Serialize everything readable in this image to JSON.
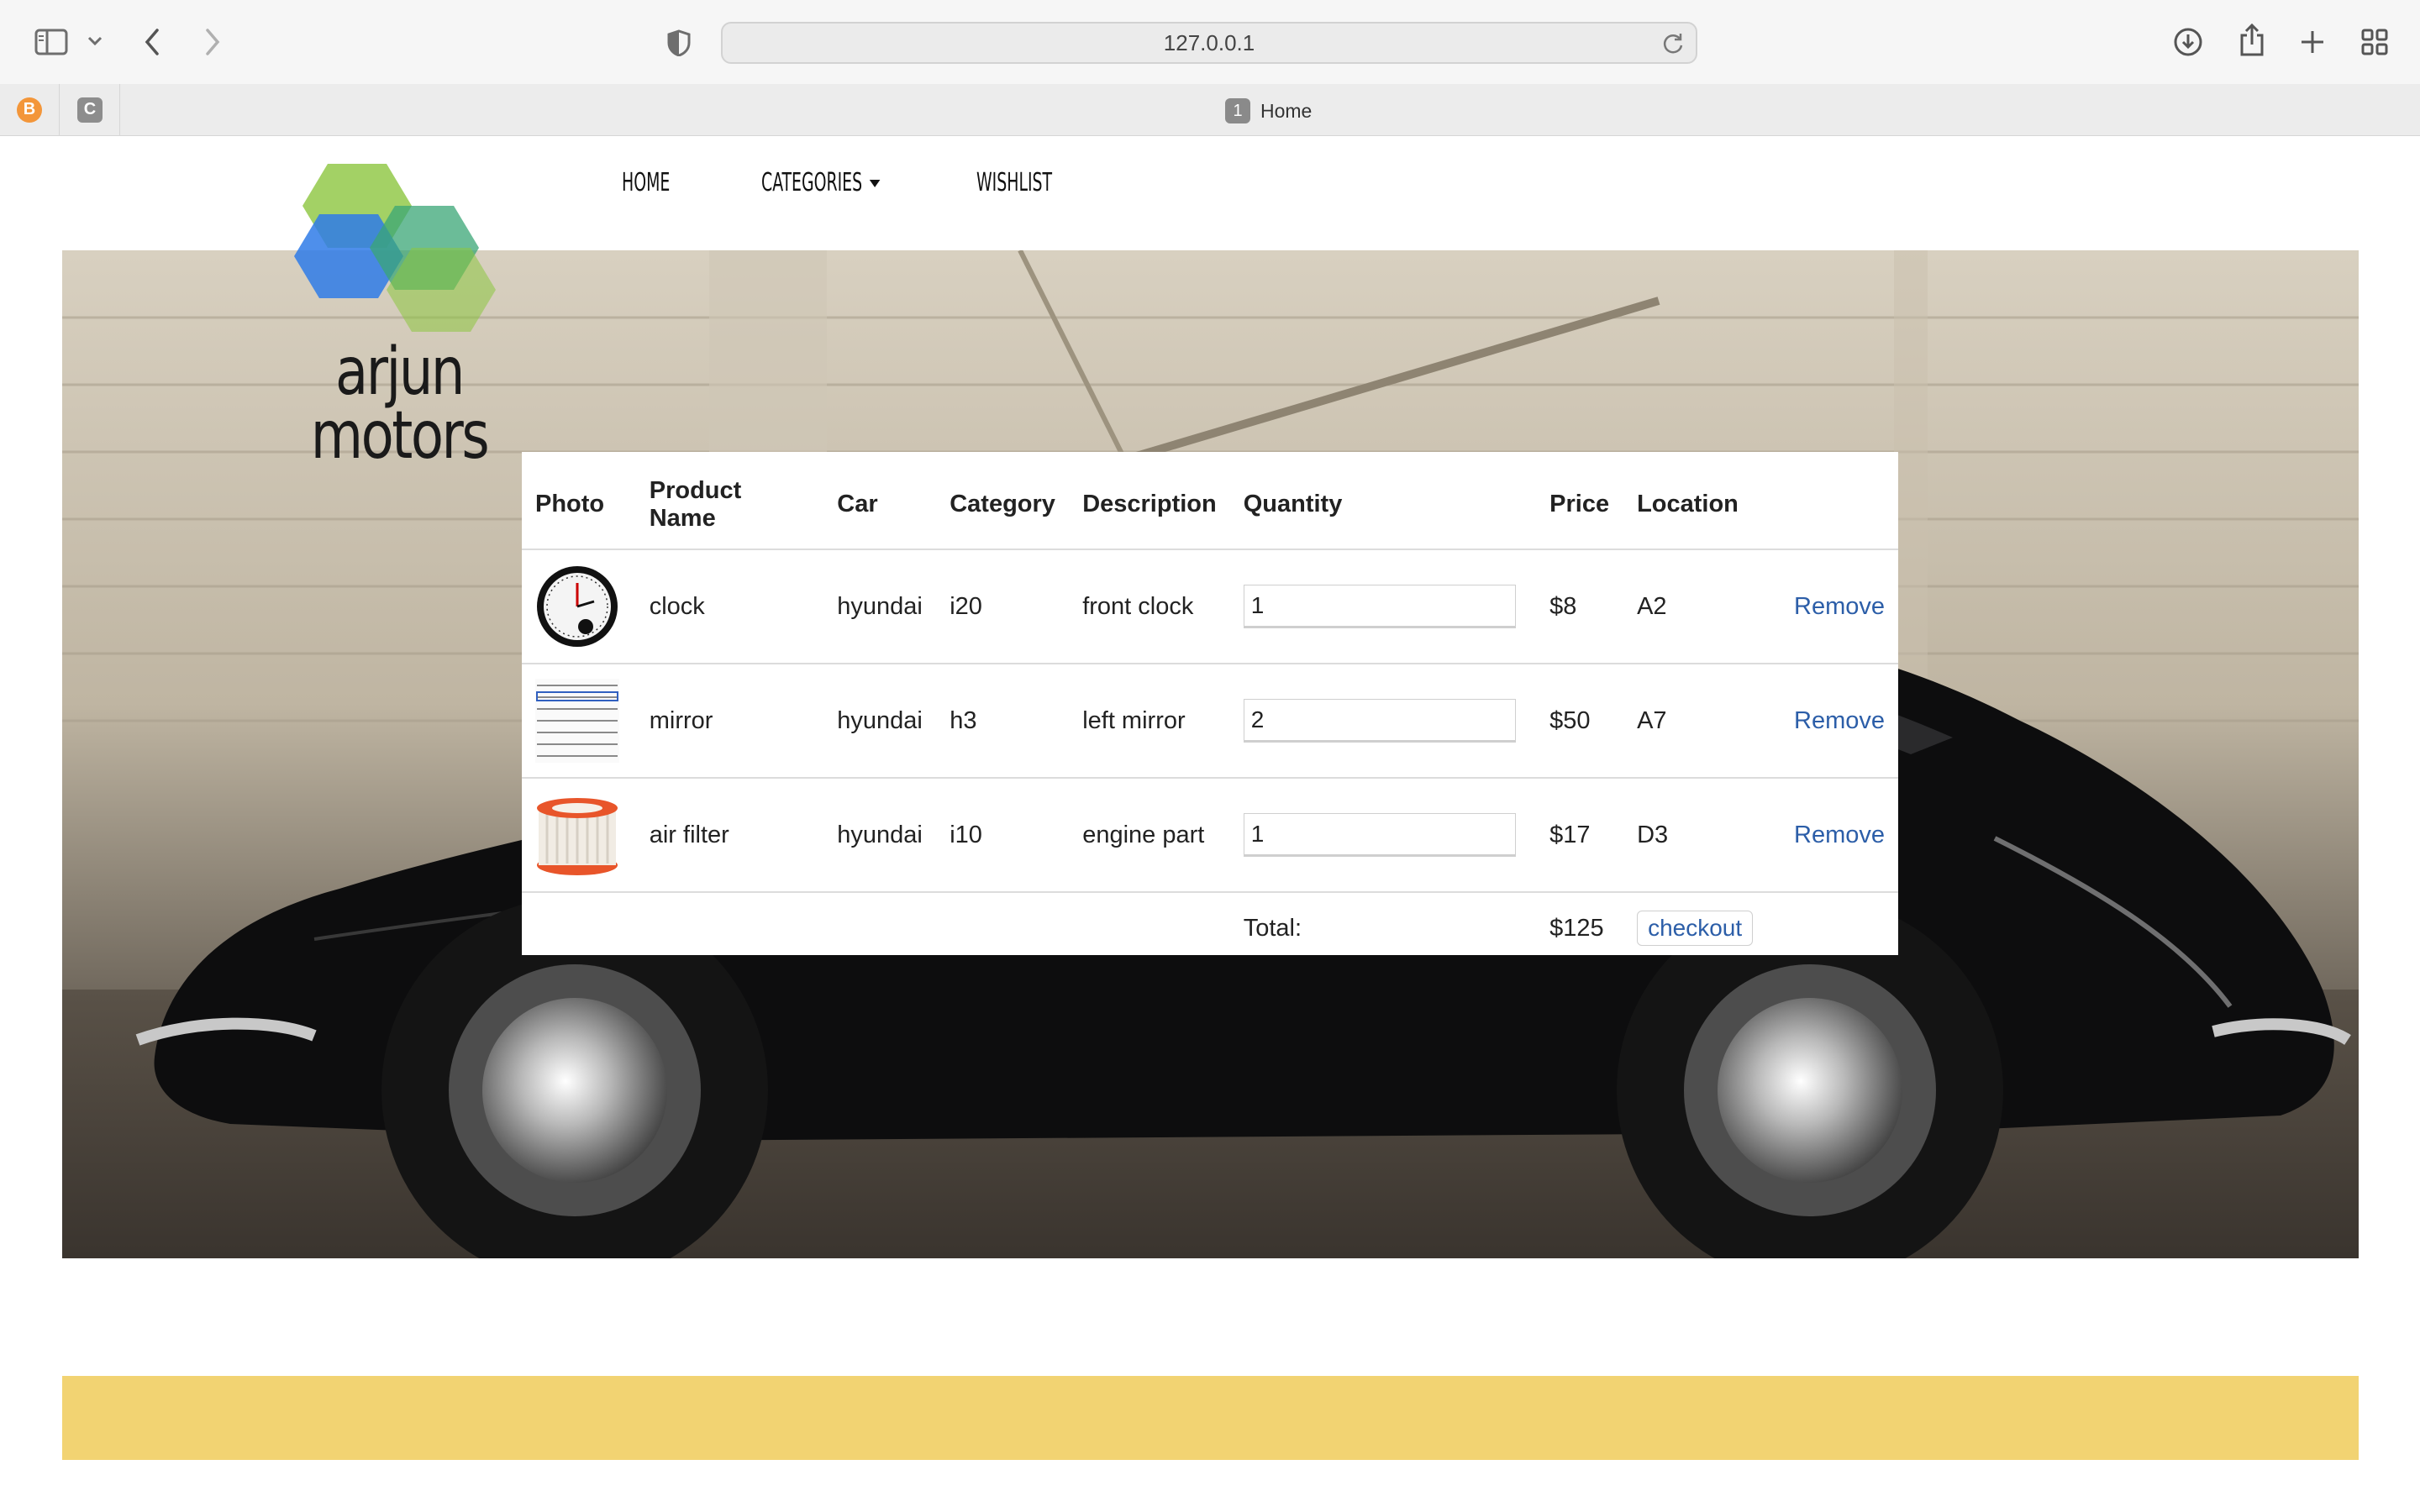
{
  "browser": {
    "url": "127.0.0.1",
    "active_tab": {
      "number": "1",
      "title": "Home"
    },
    "pinned_tabs": [
      {
        "letter": "B"
      },
      {
        "letter": "C"
      }
    ]
  },
  "site": {
    "logo_line1": "arjun",
    "logo_line2": "motors",
    "nav": {
      "home": "HOME",
      "categories": "CATEGORIES",
      "wishlist": "WISHLIST"
    }
  },
  "cart": {
    "headers": {
      "photo": "Photo",
      "name": "Product Name",
      "car": "Car",
      "category": "Category",
      "description": "Description",
      "quantity": "Quantity",
      "price": "Price",
      "location": "Location"
    },
    "items": [
      {
        "photo": "clock-photo",
        "name": "clock",
        "car": "hyundai",
        "category": "i20",
        "description": "front clock",
        "quantity": "1",
        "price": "$8",
        "location": "A2",
        "action": "Remove"
      },
      {
        "photo": "mirror-photo",
        "name": "mirror",
        "car": "hyundai",
        "category": "h3",
        "description": "left mirror",
        "quantity": "2",
        "price": "$50",
        "location": "A7",
        "action": "Remove"
      },
      {
        "photo": "air-filter-photo",
        "name": "air filter",
        "car": "hyundai",
        "category": "i10",
        "description": "engine part",
        "quantity": "1",
        "price": "$17",
        "location": "D3",
        "action": "Remove"
      }
    ],
    "total_label": "Total:",
    "total_value": "$125",
    "checkout_label": "checkout"
  },
  "colors": {
    "link": "#2c5ea8",
    "footer_bar": "#f2d372",
    "logo_green": "#8cc63f",
    "logo_blue": "#2f7be8"
  }
}
